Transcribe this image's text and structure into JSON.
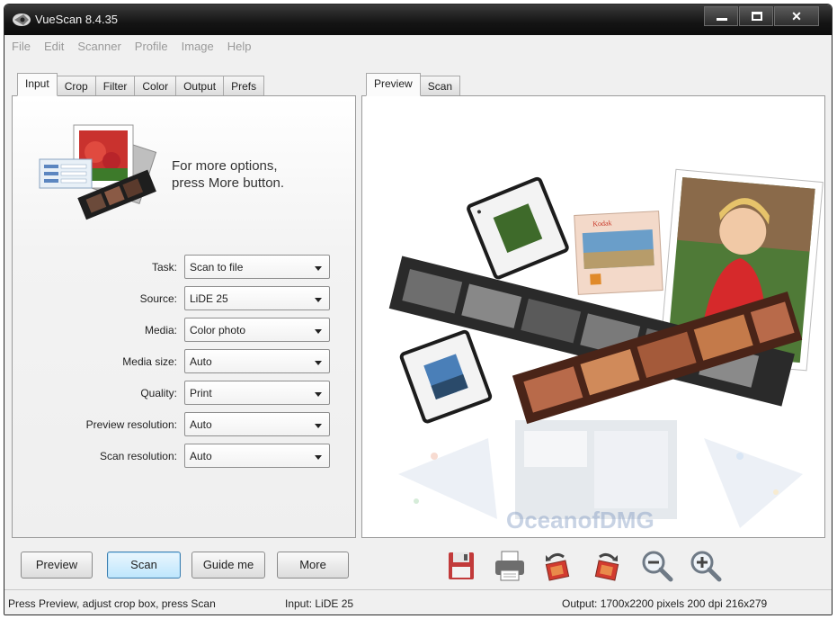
{
  "window": {
    "title": "VueScan 8.4.35"
  },
  "menu": [
    "File",
    "Edit",
    "Scanner",
    "Profile",
    "Image",
    "Help"
  ],
  "left_tabs": [
    "Input",
    "Crop",
    "Filter",
    "Color",
    "Output",
    "Prefs"
  ],
  "right_tabs": [
    "Preview",
    "Scan"
  ],
  "hint": {
    "line1": "For more options,",
    "line2": "press More button."
  },
  "form": [
    {
      "label": "Task:",
      "value": "Scan to file"
    },
    {
      "label": "Source:",
      "value": "LiDE 25"
    },
    {
      "label": "Media:",
      "value": "Color photo"
    },
    {
      "label": "Media size:",
      "value": "Auto"
    },
    {
      "label": "Quality:",
      "value": "Print"
    },
    {
      "label": "Preview resolution:",
      "value": "Auto"
    },
    {
      "label": "Scan resolution:",
      "value": "Auto"
    }
  ],
  "buttons": {
    "preview": "Preview",
    "scan": "Scan",
    "guide": "Guide me",
    "more": "More"
  },
  "toolbar_icons": [
    "save-icon",
    "print-icon",
    "rotate-left-icon",
    "rotate-right-icon",
    "zoom-out-icon",
    "zoom-in-icon"
  ],
  "status": {
    "hint": "Press Preview, adjust crop box, press Scan",
    "input": "Input: LiDE 25",
    "output": "Output: 1700x2200 pixels 200 dpi 216x279"
  },
  "watermark": "OceanofDMG",
  "colors": {
    "titlebar": "#141414",
    "accent": "#3c7fb1"
  }
}
